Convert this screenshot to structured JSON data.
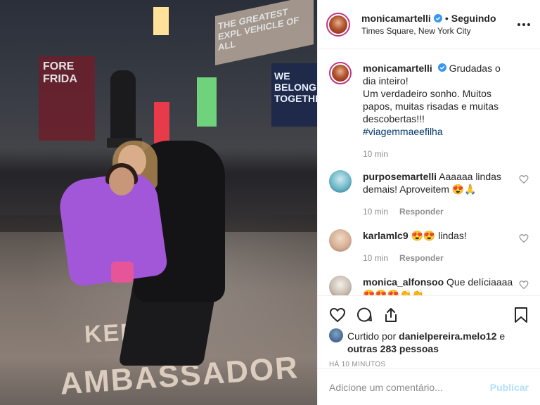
{
  "header": {
    "username": "monicamartelli",
    "follow_status": "Seguindo",
    "location": "Times Square, New York City"
  },
  "caption": {
    "username": "monicamartelli",
    "text": "Grudadas o dia inteiro!",
    "line2": "Um verdadeiro sonho. Muitos papos, muitas risadas e muitas descobertas!!!",
    "hashtag": "#viagemmaeefilha",
    "time": "10 min"
  },
  "comments": [
    {
      "username": "purposemartelli",
      "text": "Aaaaaa lindas demais! Aproveitem 😍🙏",
      "time": "10 min",
      "reply": "Responder"
    },
    {
      "username": "karlamlc9",
      "text": "😍😍 lindas!",
      "time": "10 min",
      "reply": "Responder"
    },
    {
      "username": "monica_alfonsoo",
      "text": "Que delíciaaaa 😍😍😍👏👏",
      "time": "",
      "reply": ""
    }
  ],
  "likes": {
    "prefix": "Curtido por",
    "user": "danielpereira.melo12",
    "conj": "e",
    "others": "outras 283 pessoas"
  },
  "timestamp": "HÁ 10 MINUTOS",
  "add_comment": {
    "placeholder": "Adicione um comentário...",
    "post_label": "Publicar"
  },
  "photo": {
    "billboard_a": "THE GREATEST EXPL VEHICLE OF ALL",
    "billboard_b": "WE BELONG TOGETHER",
    "sign_c": "FORE FRIDA",
    "ground_1": "AMBASSADOR",
    "ground_2": "KEN"
  },
  "colors": {
    "accent_link": "#00376b",
    "publish_disabled": "#b2dffc",
    "muted": "#8e8e8e",
    "verified": "#3897f0"
  }
}
